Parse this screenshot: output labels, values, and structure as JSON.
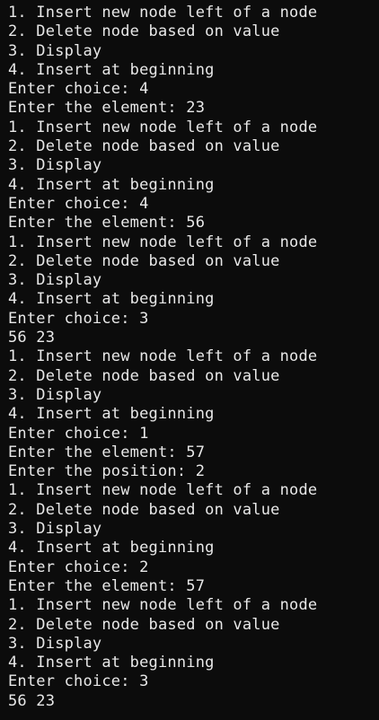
{
  "terminal": {
    "lines": [
      "1. Insert new node left of a node",
      "2. Delete node based on value",
      "3. Display",
      "4. Insert at beginning",
      "Enter choice: 4",
      "Enter the element: 23",
      "1. Insert new node left of a node",
      "2. Delete node based on value",
      "3. Display",
      "4. Insert at beginning",
      "Enter choice: 4",
      "Enter the element: 56",
      "1. Insert new node left of a node",
      "2. Delete node based on value",
      "3. Display",
      "4. Insert at beginning",
      "Enter choice: 3",
      "56 23",
      "1. Insert new node left of a node",
      "2. Delete node based on value",
      "3. Display",
      "4. Insert at beginning",
      "Enter choice: 1",
      "Enter the element: 57",
      "Enter the position: 2",
      "1. Insert new node left of a node",
      "2. Delete node based on value",
      "3. Display",
      "4. Insert at beginning",
      "Enter choice: 2",
      "Enter the element: 57",
      "1. Insert new node left of a node",
      "2. Delete node based on value",
      "3. Display",
      "4. Insert at beginning",
      "Enter choice: 3",
      "56 23"
    ]
  }
}
